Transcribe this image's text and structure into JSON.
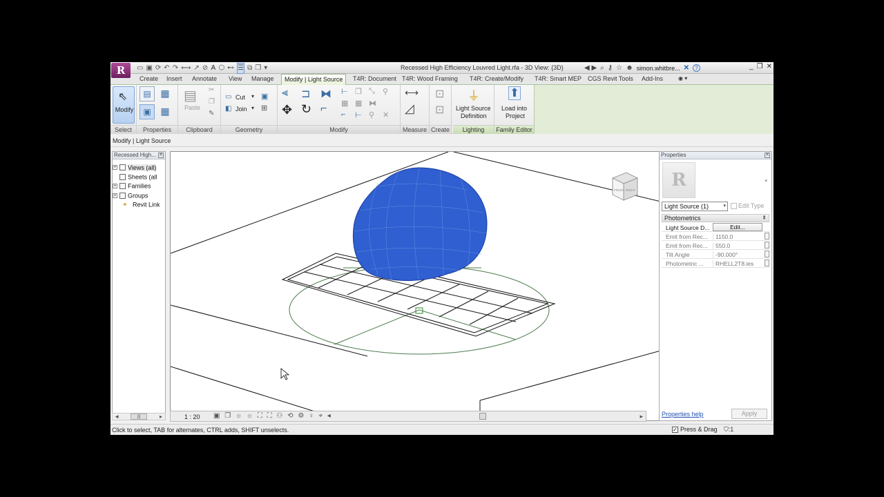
{
  "titlebar": {
    "app_letter": "R",
    "document_title": "Recessed High Efficiency Louvred Light.rfa - 3D View: {3D}",
    "user": "simon.whitbre...",
    "qat_icons": [
      "open-icon",
      "save-icon",
      "sync-icon",
      "undo-icon",
      "redo-icon",
      "measure-icon",
      "dimension-icon",
      "tag-icon",
      "text-icon",
      "3d-view-icon",
      "section-icon",
      "thin-lines-icon",
      "close-hidden-icon",
      "switch-windows-icon",
      "customize-icon"
    ],
    "glyphs": {
      "info_center": "◀ ▶",
      "binoculars": "⌕",
      "key": "⚷",
      "star": "☆",
      "user": "☻",
      "exchange": "✕",
      "help": "?",
      "minimize": "_",
      "restore": "❐",
      "close": "✕"
    }
  },
  "ribbon": {
    "tabs": [
      {
        "label": "Create"
      },
      {
        "label": "Insert"
      },
      {
        "label": "Annotate"
      },
      {
        "label": "View"
      },
      {
        "label": "Manage"
      },
      {
        "label": "Modify | Light Source",
        "active": true
      },
      {
        "label": "T4R: Document"
      },
      {
        "label": "T4R: Wood Framing"
      },
      {
        "label": "T4R: Create/Modify"
      },
      {
        "label": "T4R: Smart MEP"
      },
      {
        "label": "CGS Revit Tools"
      },
      {
        "label": "Add-Ins"
      }
    ],
    "panels": {
      "select": {
        "label": "Select",
        "modify_button": "Modify"
      },
      "properties": {
        "label": "Properties"
      },
      "clipboard": {
        "label": "Clipboard",
        "paste": "Paste"
      },
      "geometry": {
        "label": "Geometry",
        "cut": "Cut",
        "join": "Join"
      },
      "modify": {
        "label": "Modify"
      },
      "measure": {
        "label": "Measure"
      },
      "create": {
        "label": "Create"
      },
      "lighting": {
        "label": "Lighting",
        "button": "Light Source Definition",
        "line1": "Light Source",
        "line2": "Definition"
      },
      "family_editor": {
        "label": "Family Editor",
        "button": "Load into Project",
        "line1": "Load into",
        "line2": "Project"
      }
    },
    "icon_glyphs": {
      "cursor": "⇖",
      "move": "✥",
      "rotate": "↻",
      "align": "⫷",
      "offset": "⊐",
      "mirror": "⧓",
      "copy": "❐",
      "trim": "⌐",
      "split": "⊢",
      "scale": "⤡",
      "array": "▦",
      "pin": "⚲",
      "delete": "✕",
      "measure": "⟷",
      "dimension": "◿",
      "create_similar": "⊡",
      "light": "⏚",
      "load": "⬆"
    }
  },
  "options_bar": {
    "context": "Modify | Light Source"
  },
  "project_browser": {
    "title": "Recessed High...",
    "items": [
      {
        "label": "Views (all)",
        "icon": "views-icon",
        "expander": "+"
      },
      {
        "label": "Sheets (all",
        "icon": "sheets-icon",
        "expander": ""
      },
      {
        "label": "Families",
        "icon": "families-icon",
        "expander": "+"
      },
      {
        "label": "Groups",
        "icon": "groups-icon",
        "expander": "+"
      },
      {
        "label": "Revit Link",
        "icon": "revit-link-icon",
        "expander": ""
      }
    ],
    "scroll_glyphs": {
      "left": "◂",
      "thumb": "|||",
      "right": "▸"
    }
  },
  "viewport": {
    "view_cube": {
      "front": "FRONT",
      "right": "RIGHT"
    },
    "light_color": "#2f5fd0",
    "window_glyphs": {
      "minimize": "▭",
      "restore": "❐",
      "close": "✕"
    }
  },
  "view_control_bar": {
    "scale": "1 : 20",
    "icon_glyphs": "▣ ❐ ☼ ☼ ⛶ ⛶ ⚇ ⟲ ⚙ ♀ ⌖ ◂",
    "arrow_left": "◂",
    "arrow_right": "▸"
  },
  "properties": {
    "title": "Properties",
    "instance": "Light Source (1)",
    "edit_type": "Edit Type",
    "group": "Photometrics",
    "rows": [
      {
        "name": "Light Source D...",
        "value": "Edit...",
        "type": "button"
      },
      {
        "name": "Emit from Rec...",
        "value": "1150.0",
        "type": "value"
      },
      {
        "name": "Emit from Rec...",
        "value": "550.0",
        "type": "value"
      },
      {
        "name": "Tilt Angle",
        "value": "-90.000°",
        "type": "value"
      },
      {
        "name": "Photometric ...",
        "value": "RHELL2T8.ies",
        "type": "value"
      }
    ],
    "help_link": "Properties help",
    "apply": "Apply",
    "glyphs": {
      "collapse": "⇞",
      "dropdown": "▾",
      "type_preview": "R"
    }
  },
  "status_bar": {
    "message": "Click to select, TAB for alternates, CTRL adds, SHIFT unselects.",
    "press_drag": "Press & Drag",
    "press_drag_checked": true,
    "filter_count": ":1",
    "glyphs": {
      "check": "✓",
      "filter": "⛉"
    }
  }
}
